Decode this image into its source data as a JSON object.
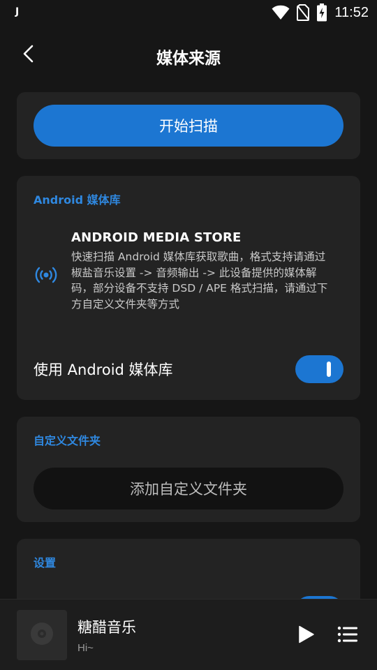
{
  "status_bar": {
    "left_glyph": "J",
    "time": "11:52",
    "icons": [
      "wifi-icon",
      "no-sim-icon",
      "battery-charging-icon"
    ]
  },
  "header": {
    "title": "媒体来源",
    "back_icon": "arrow-back-icon"
  },
  "scan_card": {
    "button_label": "开始扫描"
  },
  "android_card": {
    "section_label": "Android 媒体库",
    "store_icon": "broadcast-icon",
    "store_title": "ANDROID MEDIA STORE",
    "store_description": "快速扫描 Android 媒体库获取歌曲，格式支持请通过椒盐音乐设置 -> 音频输出 -> 此设备提供的媒体解码，部分设备不支持 DSD / APE 格式扫描，请通过下方自定义文件夹等方式",
    "toggle_label": "使用 Android 媒体库",
    "toggle_on": true
  },
  "folder_card": {
    "section_label": "自定义文件夹",
    "button_label": "添加自定义文件夹"
  },
  "settings_card": {
    "section_label": "设置"
  },
  "player": {
    "song_title": "糖醋音乐",
    "song_subtitle": "Hi~",
    "album_icon": "disc-icon",
    "play_icon": "play-icon",
    "queue_icon": "playlist-icon"
  },
  "colors": {
    "background": "#161616",
    "card": "#232323",
    "accent": "#1c76d2",
    "section_label": "#2f88e0"
  }
}
